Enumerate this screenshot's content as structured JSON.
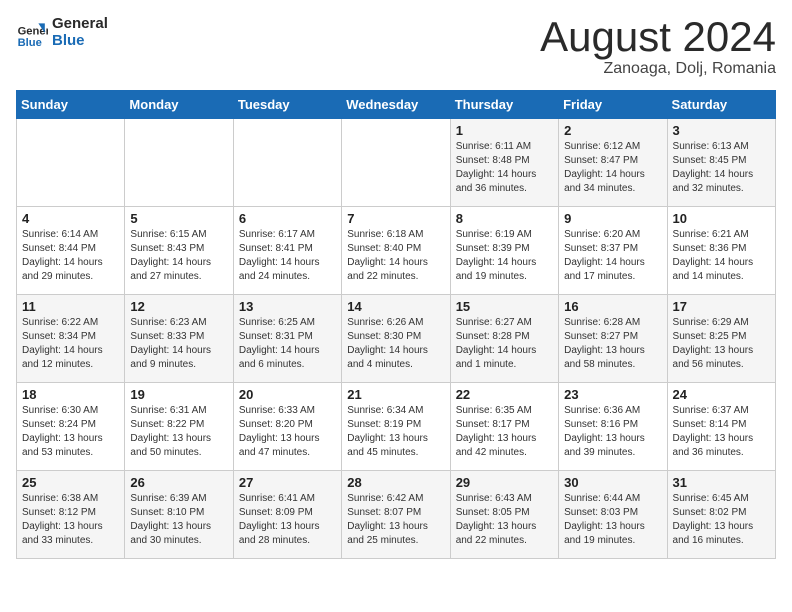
{
  "header": {
    "logo_line1": "General",
    "logo_line2": "Blue",
    "month_title": "August 2024",
    "location": "Zanoaga, Dolj, Romania"
  },
  "days_of_week": [
    "Sunday",
    "Monday",
    "Tuesday",
    "Wednesday",
    "Thursday",
    "Friday",
    "Saturday"
  ],
  "weeks": [
    [
      {
        "day": "",
        "info": ""
      },
      {
        "day": "",
        "info": ""
      },
      {
        "day": "",
        "info": ""
      },
      {
        "day": "",
        "info": ""
      },
      {
        "day": "1",
        "info": "Sunrise: 6:11 AM\nSunset: 8:48 PM\nDaylight: 14 hours and 36 minutes."
      },
      {
        "day": "2",
        "info": "Sunrise: 6:12 AM\nSunset: 8:47 PM\nDaylight: 14 hours and 34 minutes."
      },
      {
        "day": "3",
        "info": "Sunrise: 6:13 AM\nSunset: 8:45 PM\nDaylight: 14 hours and 32 minutes."
      }
    ],
    [
      {
        "day": "4",
        "info": "Sunrise: 6:14 AM\nSunset: 8:44 PM\nDaylight: 14 hours and 29 minutes."
      },
      {
        "day": "5",
        "info": "Sunrise: 6:15 AM\nSunset: 8:43 PM\nDaylight: 14 hours and 27 minutes."
      },
      {
        "day": "6",
        "info": "Sunrise: 6:17 AM\nSunset: 8:41 PM\nDaylight: 14 hours and 24 minutes."
      },
      {
        "day": "7",
        "info": "Sunrise: 6:18 AM\nSunset: 8:40 PM\nDaylight: 14 hours and 22 minutes."
      },
      {
        "day": "8",
        "info": "Sunrise: 6:19 AM\nSunset: 8:39 PM\nDaylight: 14 hours and 19 minutes."
      },
      {
        "day": "9",
        "info": "Sunrise: 6:20 AM\nSunset: 8:37 PM\nDaylight: 14 hours and 17 minutes."
      },
      {
        "day": "10",
        "info": "Sunrise: 6:21 AM\nSunset: 8:36 PM\nDaylight: 14 hours and 14 minutes."
      }
    ],
    [
      {
        "day": "11",
        "info": "Sunrise: 6:22 AM\nSunset: 8:34 PM\nDaylight: 14 hours and 12 minutes."
      },
      {
        "day": "12",
        "info": "Sunrise: 6:23 AM\nSunset: 8:33 PM\nDaylight: 14 hours and 9 minutes."
      },
      {
        "day": "13",
        "info": "Sunrise: 6:25 AM\nSunset: 8:31 PM\nDaylight: 14 hours and 6 minutes."
      },
      {
        "day": "14",
        "info": "Sunrise: 6:26 AM\nSunset: 8:30 PM\nDaylight: 14 hours and 4 minutes."
      },
      {
        "day": "15",
        "info": "Sunrise: 6:27 AM\nSunset: 8:28 PM\nDaylight: 14 hours and 1 minute."
      },
      {
        "day": "16",
        "info": "Sunrise: 6:28 AM\nSunset: 8:27 PM\nDaylight: 13 hours and 58 minutes."
      },
      {
        "day": "17",
        "info": "Sunrise: 6:29 AM\nSunset: 8:25 PM\nDaylight: 13 hours and 56 minutes."
      }
    ],
    [
      {
        "day": "18",
        "info": "Sunrise: 6:30 AM\nSunset: 8:24 PM\nDaylight: 13 hours and 53 minutes."
      },
      {
        "day": "19",
        "info": "Sunrise: 6:31 AM\nSunset: 8:22 PM\nDaylight: 13 hours and 50 minutes."
      },
      {
        "day": "20",
        "info": "Sunrise: 6:33 AM\nSunset: 8:20 PM\nDaylight: 13 hours and 47 minutes."
      },
      {
        "day": "21",
        "info": "Sunrise: 6:34 AM\nSunset: 8:19 PM\nDaylight: 13 hours and 45 minutes."
      },
      {
        "day": "22",
        "info": "Sunrise: 6:35 AM\nSunset: 8:17 PM\nDaylight: 13 hours and 42 minutes."
      },
      {
        "day": "23",
        "info": "Sunrise: 6:36 AM\nSunset: 8:16 PM\nDaylight: 13 hours and 39 minutes."
      },
      {
        "day": "24",
        "info": "Sunrise: 6:37 AM\nSunset: 8:14 PM\nDaylight: 13 hours and 36 minutes."
      }
    ],
    [
      {
        "day": "25",
        "info": "Sunrise: 6:38 AM\nSunset: 8:12 PM\nDaylight: 13 hours and 33 minutes."
      },
      {
        "day": "26",
        "info": "Sunrise: 6:39 AM\nSunset: 8:10 PM\nDaylight: 13 hours and 30 minutes."
      },
      {
        "day": "27",
        "info": "Sunrise: 6:41 AM\nSunset: 8:09 PM\nDaylight: 13 hours and 28 minutes."
      },
      {
        "day": "28",
        "info": "Sunrise: 6:42 AM\nSunset: 8:07 PM\nDaylight: 13 hours and 25 minutes."
      },
      {
        "day": "29",
        "info": "Sunrise: 6:43 AM\nSunset: 8:05 PM\nDaylight: 13 hours and 22 minutes."
      },
      {
        "day": "30",
        "info": "Sunrise: 6:44 AM\nSunset: 8:03 PM\nDaylight: 13 hours and 19 minutes."
      },
      {
        "day": "31",
        "info": "Sunrise: 6:45 AM\nSunset: 8:02 PM\nDaylight: 13 hours and 16 minutes."
      }
    ]
  ]
}
